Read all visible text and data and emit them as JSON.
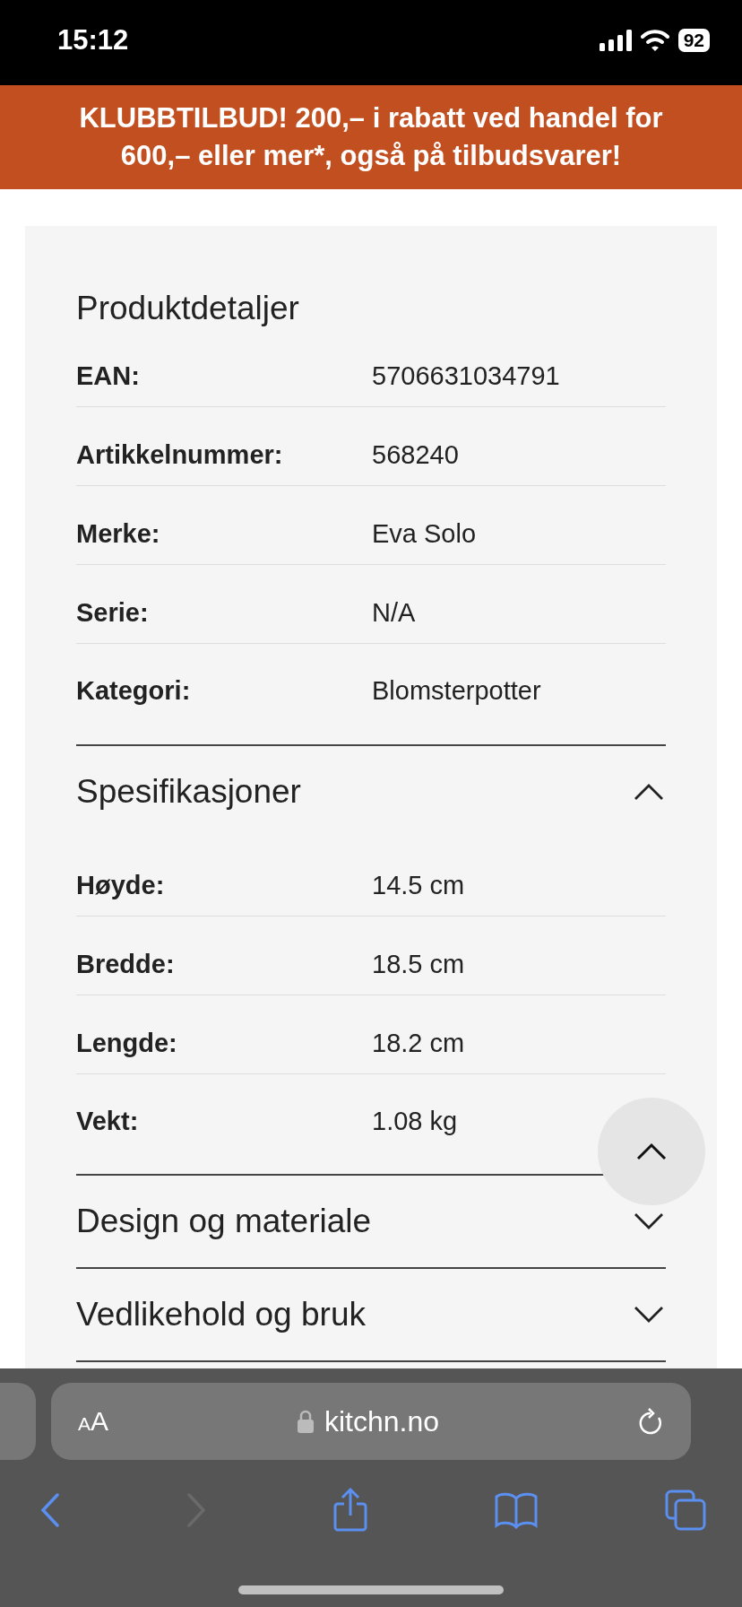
{
  "status_bar": {
    "time": "15:12",
    "battery": "92"
  },
  "banner": {
    "text": "KLUBBTILBUD! 200,– i rabatt ved handel for 600,– eller mer*, også på tilbudsvarer!"
  },
  "product_details": {
    "title": "Produktdetaljer",
    "rows": [
      {
        "label": "EAN:",
        "value": "5706631034791"
      },
      {
        "label": "Artikkelnummer:",
        "value": "568240"
      },
      {
        "label": "Merke:",
        "value": "Eva Solo"
      },
      {
        "label": "Serie:",
        "value": "N/A"
      },
      {
        "label": "Kategori:",
        "value": "Blomsterpotter"
      }
    ]
  },
  "sections": [
    {
      "title": "Spesifikasjoner",
      "expanded": true,
      "rows": [
        {
          "label": "Høyde:",
          "value": "14.5 cm"
        },
        {
          "label": "Bredde:",
          "value": "18.5 cm"
        },
        {
          "label": "Lengde:",
          "value": "18.2 cm"
        },
        {
          "label": "Vekt:",
          "value": "1.08 kg"
        }
      ]
    },
    {
      "title": "Design og materiale",
      "expanded": false
    },
    {
      "title": "Vedlikehold og bruk",
      "expanded": false
    }
  ],
  "browser": {
    "text_size_button": "AA",
    "url": "kitchn.no",
    "forward_enabled": false
  }
}
